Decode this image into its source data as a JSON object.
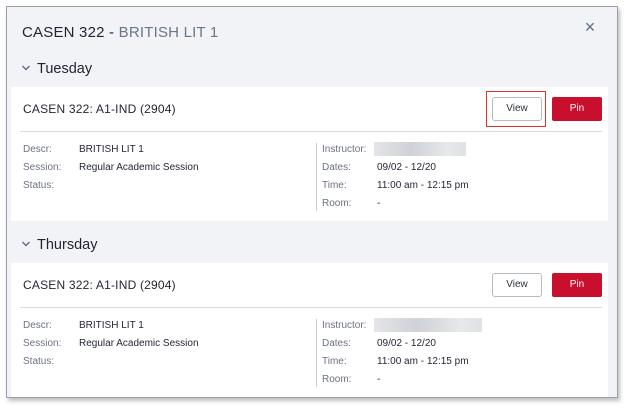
{
  "dialog": {
    "course_code": "CASEN 322",
    "separator": " - ",
    "course_name": "BRITISH LIT 1",
    "close_icon": "×"
  },
  "days": [
    {
      "label": "Tuesday",
      "section_title": "CASEN 322: A1-IND (2904)",
      "view_label": "View",
      "pin_label": "Pin",
      "descr_label": "Descr:",
      "descr_value": "BRITISH LIT 1",
      "session_label": "Session:",
      "session_value": "Regular Academic Session",
      "status_label": "Status:",
      "instructor_label": "Instructor:",
      "dates_label": "Dates:",
      "dates_value": "09/02 - 12/20",
      "time_label": "Time:",
      "time_value": "11:00 am - 12:15 pm",
      "room_label": "Room:",
      "room_value": "-"
    },
    {
      "label": "Thursday",
      "section_title": "CASEN 322: A1-IND (2904)",
      "view_label": "View",
      "pin_label": "Pin",
      "descr_label": "Descr:",
      "descr_value": "BRITISH LIT 1",
      "session_label": "Session:",
      "session_value": "Regular Academic Session",
      "status_label": "Status:",
      "instructor_label": "Instructor:",
      "dates_label": "Dates:",
      "dates_value": "09/02 - 12/20",
      "time_label": "Time:",
      "time_value": "11:00 am - 12:15 pm",
      "room_label": "Room:",
      "room_value": "-"
    }
  ],
  "colors": {
    "accent_red": "#c8102e",
    "focus_outline": "#e0312b",
    "panel_bg": "#f1f3f6"
  }
}
